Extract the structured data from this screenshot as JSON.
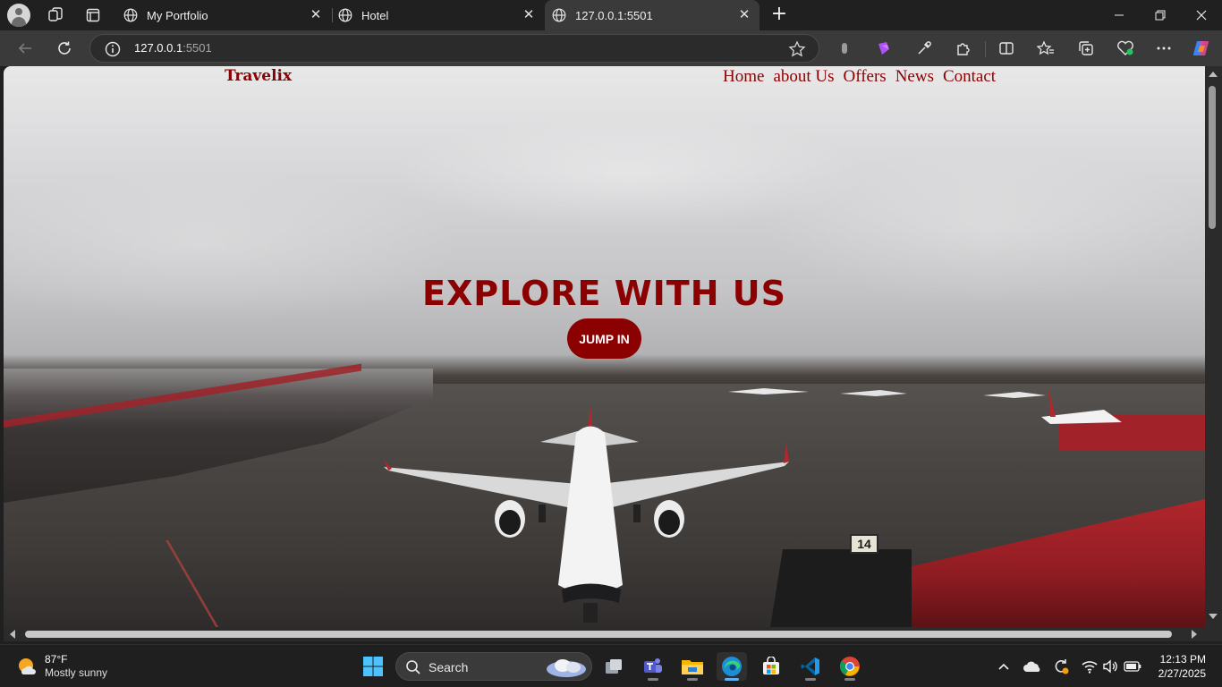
{
  "browser": {
    "tabs": [
      {
        "title": "My Portfolio",
        "active": false
      },
      {
        "title": "Hotel",
        "active": false
      },
      {
        "title": "127.0.0.1:5501",
        "active": true
      }
    ],
    "url_host": "127.0.0.1",
    "url_port": ":5501"
  },
  "page": {
    "logo": "Travelix",
    "menu": [
      "Home",
      "about Us",
      "Offers",
      "News",
      "Contact"
    ],
    "hero_title": "EXPLORE WITH US",
    "hero_button": "JUMP IN",
    "gate_sign": "14",
    "colors": {
      "brand": "#8b0000",
      "button_text": "#ffffff"
    }
  },
  "taskbar": {
    "weather_temp": "87°F",
    "weather_cond": "Mostly sunny",
    "search_label": "Search",
    "time": "12:13 PM",
    "date": "2/27/2025",
    "pinned": [
      "file-explorer",
      "teams",
      "folder",
      "edge",
      "store",
      "vscode",
      "chrome"
    ]
  }
}
